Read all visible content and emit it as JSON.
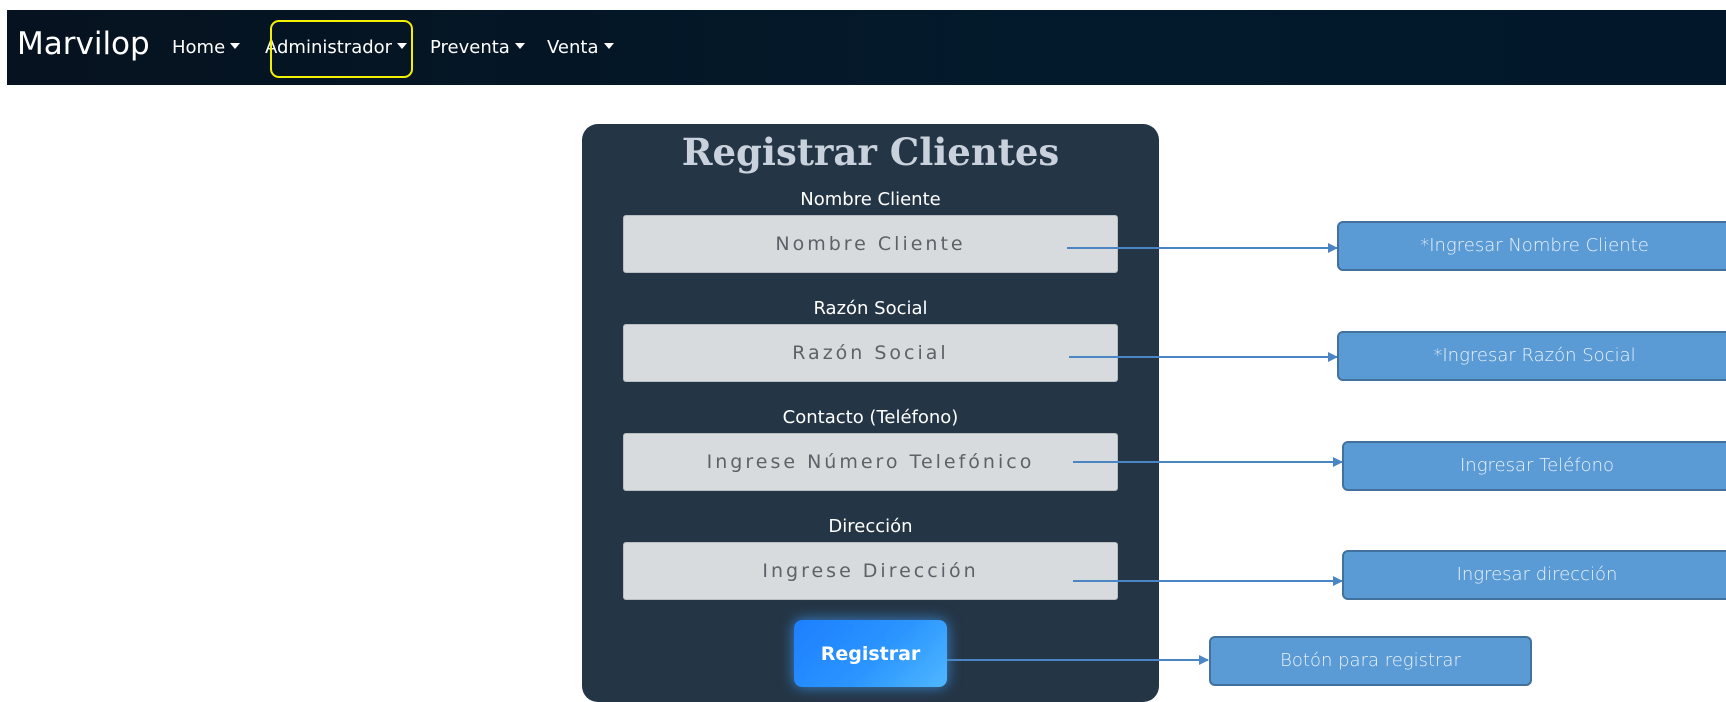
{
  "navbar": {
    "brand": "Marvilop",
    "items": [
      {
        "label": "Home"
      },
      {
        "label": "Administrador"
      },
      {
        "label": "Preventa"
      },
      {
        "label": "Venta"
      }
    ],
    "highlight_color": "#f2f200",
    "background": "#031a2c"
  },
  "form": {
    "title": "Registrar Clientes",
    "fields": [
      {
        "label": "Nombre Cliente",
        "placeholder": "Nombre Cliente"
      },
      {
        "label": "Razón Social",
        "placeholder": "Razón Social"
      },
      {
        "label": "Contacto (Teléfono)",
        "placeholder": "Ingrese Número Telefónico"
      },
      {
        "label": "Dirección",
        "placeholder": "Ingrese Dirección"
      }
    ],
    "submit_label": "Registrar",
    "card_color": "#243545",
    "button_color": "#2b95ff"
  },
  "annotations": [
    {
      "text": "*Ingresar Nombre Cliente"
    },
    {
      "text": "*Ingresar Razón Social"
    },
    {
      "text": "Ingresar Teléfono"
    },
    {
      "text": "Ingresar dirección"
    },
    {
      "text": "Botón para registrar"
    }
  ],
  "annotation_color": "#5b9bd5"
}
